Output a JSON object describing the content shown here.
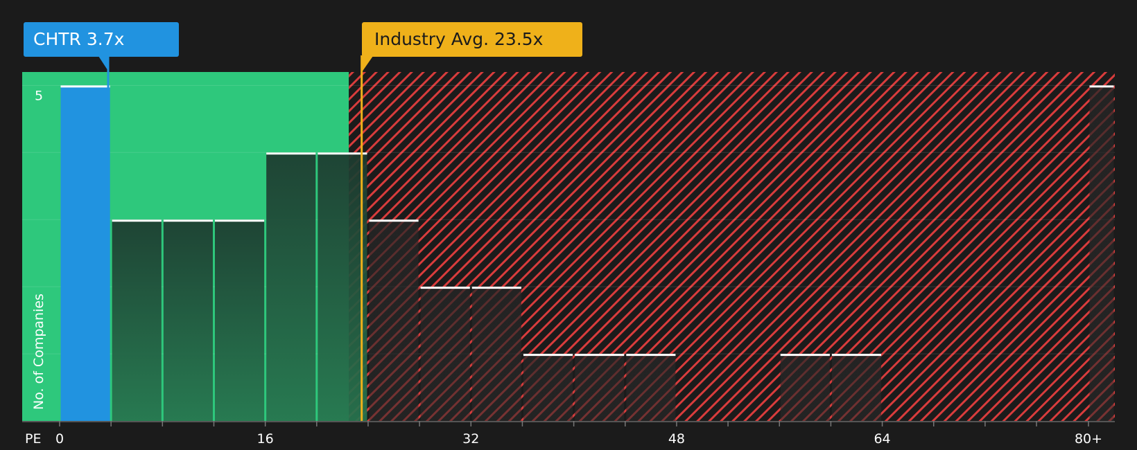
{
  "chart_data": {
    "type": "bar",
    "title": "",
    "xlabel": "PE",
    "ylabel": "No. of Companies",
    "x_tick_labels": [
      "0",
      "16",
      "32",
      "48",
      "64",
      "80+"
    ],
    "y_tick_labels": [
      "5"
    ],
    "ylim": [
      0,
      5.2
    ],
    "bin_width": 4,
    "bins": [
      {
        "start": 0,
        "end": 4,
        "count": 5
      },
      {
        "start": 4,
        "end": 8,
        "count": 3
      },
      {
        "start": 8,
        "end": 12,
        "count": 3
      },
      {
        "start": 12,
        "end": 16,
        "count": 3
      },
      {
        "start": 16,
        "end": 20,
        "count": 4
      },
      {
        "start": 20,
        "end": 24,
        "count": 4
      },
      {
        "start": 24,
        "end": 28,
        "count": 3
      },
      {
        "start": 28,
        "end": 32,
        "count": 2
      },
      {
        "start": 32,
        "end": 36,
        "count": 2
      },
      {
        "start": 36,
        "end": 40,
        "count": 1
      },
      {
        "start": 40,
        "end": 44,
        "count": 1
      },
      {
        "start": 44,
        "end": 48,
        "count": 1
      },
      {
        "start": 48,
        "end": 52,
        "count": 0
      },
      {
        "start": 52,
        "end": 56,
        "count": 0
      },
      {
        "start": 56,
        "end": 60,
        "count": 1
      },
      {
        "start": 60,
        "end": 64,
        "count": 1
      },
      {
        "start": 64,
        "end": 68,
        "count": 0
      },
      {
        "start": 68,
        "end": 72,
        "count": 0
      },
      {
        "start": 72,
        "end": 76,
        "count": 0
      },
      {
        "start": 76,
        "end": 80,
        "count": 0
      },
      {
        "start": 80,
        "end": 82,
        "count": 5
      }
    ],
    "highlight_bin_index": 0,
    "company_value": 3.7,
    "industry_avg_value": 23.5,
    "fair_zone_end": 22.5,
    "company_label": "CHTR 3.7x",
    "industry_label": "Industry Avg. 23.5x",
    "colors": {
      "background": "#1b1b1b",
      "good_zone": "#2ec87c",
      "bad_zone_hatch": "#d93c3c",
      "highlight_bar": "#2193e0",
      "industry_marker": "#efb11a",
      "bar_top": "#ffffff"
    }
  }
}
